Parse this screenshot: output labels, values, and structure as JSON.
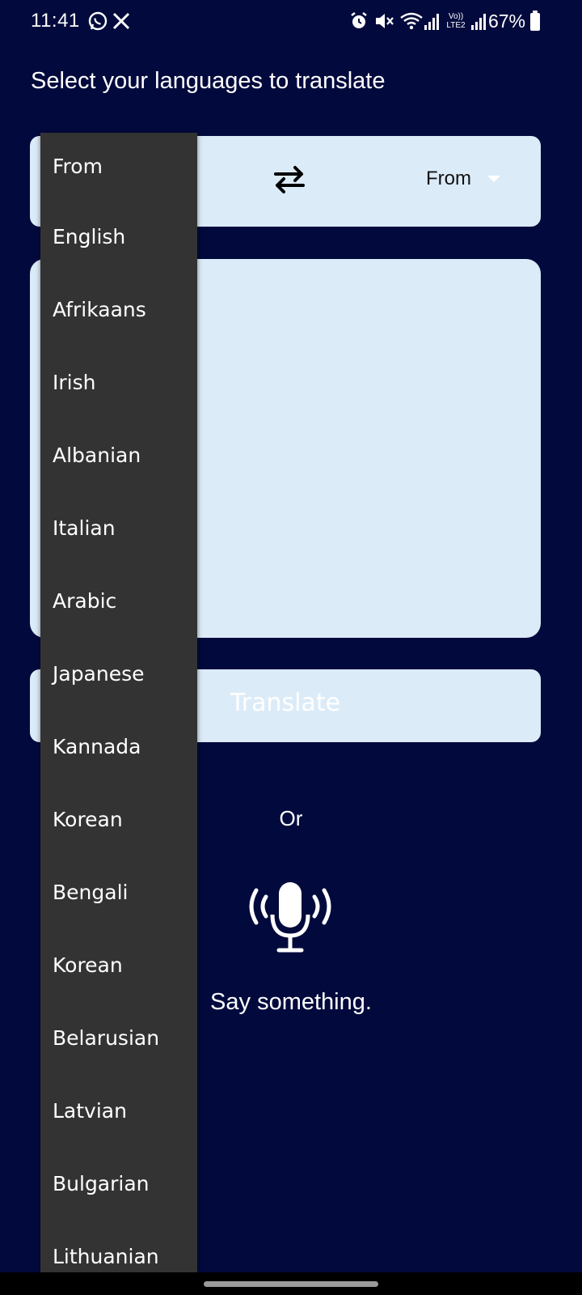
{
  "status_bar": {
    "time": "11:41",
    "icons": [
      "whatsapp-icon",
      "x-icon",
      "alarm-icon",
      "mute-icon",
      "wifi-icon",
      "signal-icon",
      "volte-icon",
      "signal-icon"
    ],
    "volte_text": "Vo)) LTE2",
    "battery": "67%"
  },
  "heading": "Select your languages to translate",
  "language_bar": {
    "to_value": "From"
  },
  "translate_button": "Translate",
  "or_label": "Or",
  "say_label": "Say something.",
  "dropdown": {
    "items": [
      "From",
      "English",
      "Afrikaans",
      "Irish",
      "Albanian",
      "Italian",
      "Arabic",
      "Japanese",
      "Kannada",
      "Korean",
      "Bengali",
      "Korean",
      "Belarusian",
      "Latvian",
      "Bulgarian",
      "Lithuanian"
    ]
  },
  "colors": {
    "background": "#020a3d",
    "panel": "#dcebf8",
    "dropdown": "#333333"
  }
}
